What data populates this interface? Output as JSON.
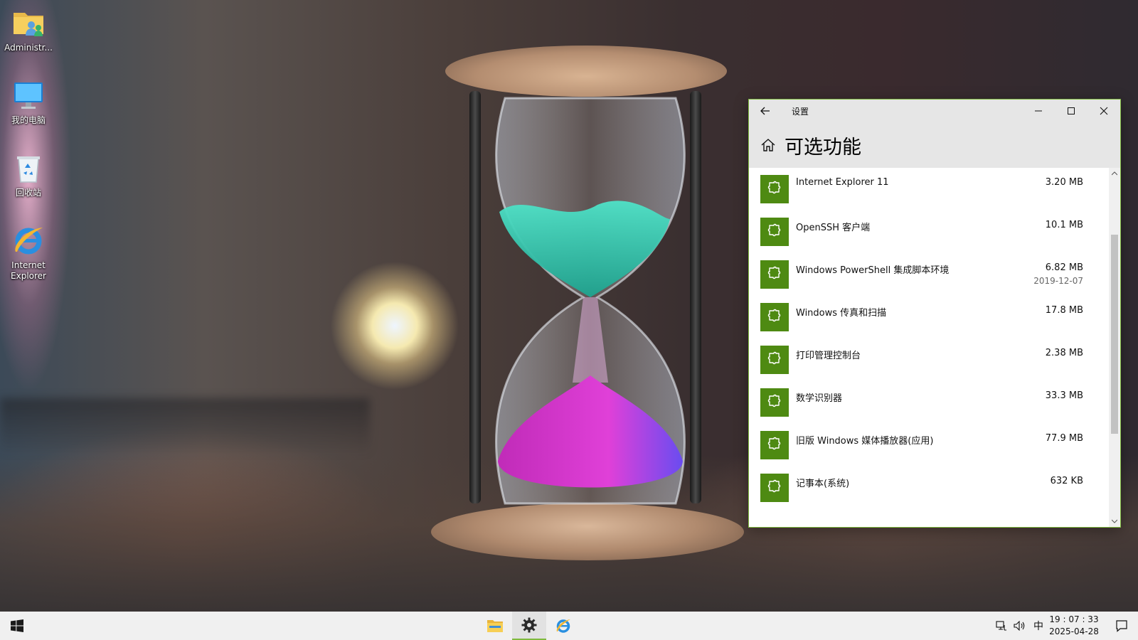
{
  "desktop": {
    "icons": [
      {
        "label": "Administr...",
        "icon": "user-folder-icon"
      },
      {
        "label": "我的电脑",
        "icon": "computer-icon"
      },
      {
        "label": "回收站",
        "icon": "recycle-bin-icon"
      },
      {
        "label": "Internet Explorer",
        "icon": "ie-icon"
      }
    ]
  },
  "window": {
    "title": "设置",
    "page_title": "可选功能",
    "accent": "#7fba3e",
    "tile_color": "#4e8a12",
    "features": [
      {
        "name": "Internet Explorer 11",
        "size": "3.20 MB",
        "date": ""
      },
      {
        "name": "OpenSSH 客户端",
        "size": "10.1 MB",
        "date": ""
      },
      {
        "name": "Windows PowerShell 集成脚本环境",
        "size": "6.82 MB",
        "date": "2019-12-07"
      },
      {
        "name": "Windows 传真和扫描",
        "size": "17.8 MB",
        "date": ""
      },
      {
        "name": "打印管理控制台",
        "size": "2.38 MB",
        "date": ""
      },
      {
        "name": "数学识别器",
        "size": "33.3 MB",
        "date": ""
      },
      {
        "name": "旧版 Windows 媒体播放器(应用)",
        "size": "77.9 MB",
        "date": ""
      },
      {
        "name": "记事本(系统)",
        "size": "632 KB",
        "date": ""
      }
    ],
    "scroll_position": 0.4
  },
  "taskbar": {
    "apps": [
      {
        "name": "file-explorer",
        "icon": "folder-icon",
        "active": false
      },
      {
        "name": "settings",
        "icon": "gear-icon",
        "active": true
      },
      {
        "name": "internet-explorer",
        "icon": "ie-icon",
        "active": false
      }
    ],
    "ime": "中",
    "time": "19 : 07 : 33",
    "date": "2025-04-28"
  }
}
